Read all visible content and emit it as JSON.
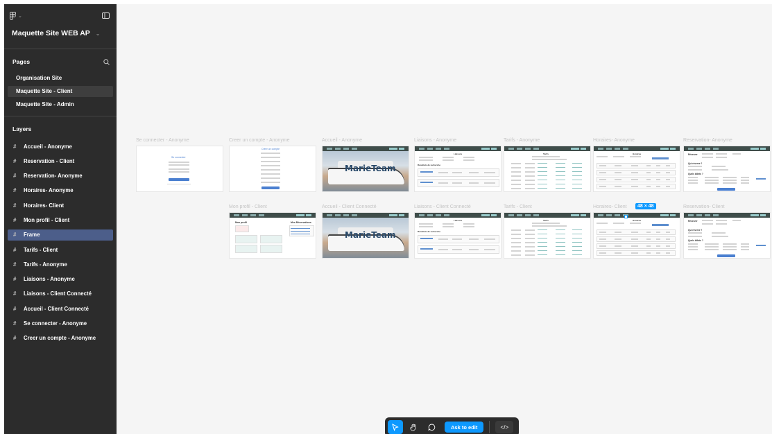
{
  "file": {
    "name": "Maquette Site WEB AP"
  },
  "pages": {
    "title": "Pages",
    "items": [
      {
        "label": "Organisation Site",
        "selected": false
      },
      {
        "label": "Maquette Site - Client",
        "selected": true
      },
      {
        "label": "Maquette Site - Admin",
        "selected": false
      }
    ]
  },
  "layers": {
    "title": "Layers",
    "items": [
      {
        "label": "Accueil - Anonyme",
        "selected": false
      },
      {
        "label": "Reservation - Client",
        "selected": false
      },
      {
        "label": "Reservation- Anonyme",
        "selected": false
      },
      {
        "label": "Horaires- Anonyme",
        "selected": false
      },
      {
        "label": "Horaires- Client",
        "selected": false
      },
      {
        "label": "Mon profil - Client",
        "selected": false
      },
      {
        "label": "Frame",
        "selected": true
      },
      {
        "label": "Tarifs - Client",
        "selected": false
      },
      {
        "label": "Tarifs - Anonyme",
        "selected": false
      },
      {
        "label": "Liaisons - Anonyme",
        "selected": false
      },
      {
        "label": "Liaisons - Client Connecté",
        "selected": false
      },
      {
        "label": "Accueil - Client Connecté",
        "selected": false
      },
      {
        "label": "Se connecter - Anonyme",
        "selected": false
      },
      {
        "label": "Creer un compte - Anonyme",
        "selected": false
      }
    ]
  },
  "canvas": {
    "row1": [
      {
        "label": "Se connecter - Anonyme",
        "kind": "login"
      },
      {
        "label": "Creer un compte - Anonyme",
        "kind": "signup"
      },
      {
        "label": "Accueil - Anonyme",
        "kind": "home"
      },
      {
        "label": "Liaisons - Anonyme",
        "kind": "liaisons"
      },
      {
        "label": "Tarifs - Anonyme",
        "kind": "tarifs"
      },
      {
        "label": "Horaires- Anonyme",
        "kind": "horaires"
      },
      {
        "label": "Reservation- Anonyme",
        "kind": "reservation"
      }
    ],
    "row2": [
      {
        "label": "Mon profil - Client",
        "kind": "profil"
      },
      {
        "label": "Accueil - Client Connecté",
        "kind": "home"
      },
      {
        "label": "Liaisons - Client Connecté",
        "kind": "liaisons"
      },
      {
        "label": "Tarifs - Client",
        "kind": "tarifs"
      },
      {
        "label": "Horaires- Client",
        "kind": "horaires"
      },
      {
        "label": "Reservation- Client",
        "kind": "reservation"
      }
    ],
    "home_title": "MarieTeam",
    "liaisons_heading": "Liaisons",
    "liaisons_results": "Résultats de recherche",
    "tarifs_heading": "Tarifs",
    "horaires_heading": "Horaires",
    "reservation_heading": "Réserver",
    "reservation_sub": "Qui réserve ?",
    "reservation_sub2": "Quels billets ?",
    "profil_heading": "Mon profil",
    "profil_side": "Mes Réservations",
    "login_heading": "Se connecter",
    "signup_heading": "Créer un compte",
    "size_badge": "48 × 48"
  },
  "toolbar": {
    "ask_label": "Ask to edit"
  },
  "colors": {
    "accent": "#0d99ff",
    "sidebar": "#2c2c2c",
    "selected_layer": "#4c5e8a"
  }
}
